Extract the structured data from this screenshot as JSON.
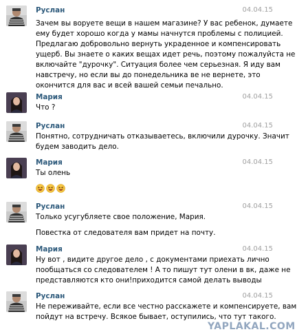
{
  "messages": [
    {
      "author": "Руслан",
      "date": "04.04.15",
      "lines": [
        "Зачем вы воруете вещи в нашем магазине? У вас ребенок, думаете",
        "ему будет хорошо когда у мамы начнутся проблемы с полицией.",
        "Предлагаю добровольно вернуть украденное и компенсировать",
        "ущерб. Вы знаете о каких вещах идет речь, поэтому пожалуйста не",
        "включайте \"дурочку\". Ситуация более чем серьезная. Я иду вам",
        "навстречу, но если вы до понедельника ве не вернете, это",
        "окончится для вас и всей вашей семьи печально."
      ]
    },
    {
      "author": "Мария",
      "date": "04.04.15",
      "lines": [
        "Что ?"
      ]
    },
    {
      "author": "Руслан",
      "date": "04.04.15",
      "lines": [
        "Понятно, сотрудничать отказываетесь, включили дурочку. Значит",
        "будем заводить дело."
      ]
    },
    {
      "author": "Мария",
      "date": "04.04.15",
      "lines": [
        "Ты олень"
      ],
      "emoji_count": 3
    },
    {
      "author": "Руслан",
      "date": "04.04.15",
      "lines": [
        "Только усугубляете свое положение, Мария."
      ],
      "lines2": [
        "Повестка от следователя вам придет на почту."
      ]
    },
    {
      "author": "Мария",
      "date": "04.04.15",
      "lines": [
        "Ну вот , видите другое дело , с документами приехать лично",
        "пообщаться со следователем ! А то пишут тут олени в вк, даже не",
        "представляются кто они!приходится самой делать выводы"
      ]
    },
    {
      "author": "Руслан",
      "date": "04.04.15",
      "lines": [
        "Не переживайте, если все честно расскажете и компенсируете, вам",
        "пойдут на встречу. Всякое бывает, оступились, что тут такого."
      ]
    }
  ],
  "watermark": "YAPLAKAL.COM",
  "colors": {
    "author": "#2b587a",
    "date": "#a0a0a0",
    "emoji": "#f5c542"
  },
  "icons": {
    "ruslan_avatar": "person-photo-icon",
    "maria_avatar": "person-photo-icon",
    "emoji": "laughing-face-icon"
  }
}
